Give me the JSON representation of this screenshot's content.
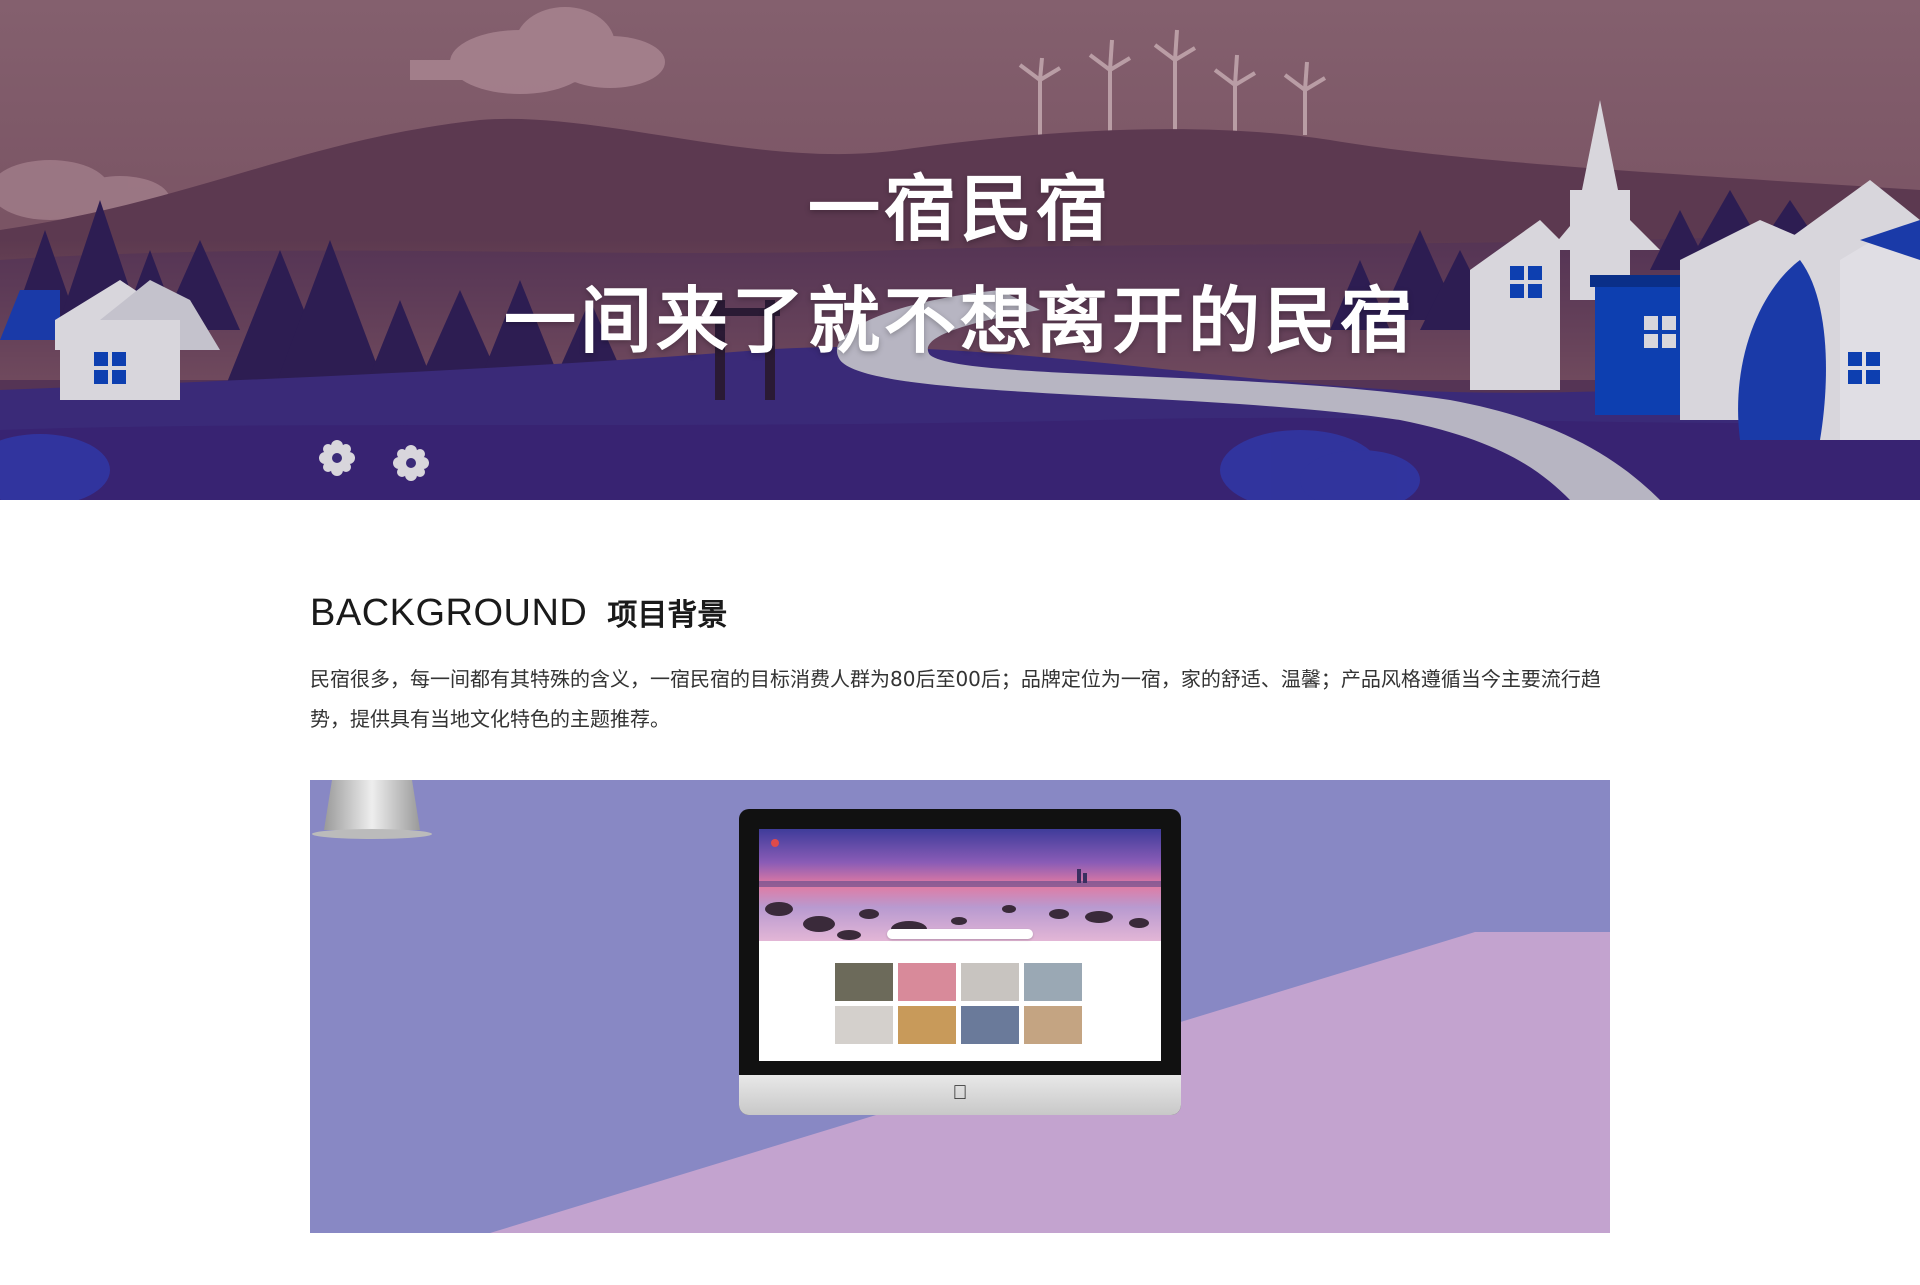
{
  "hero": {
    "title": "一宿民宿",
    "subtitle": "一间来了就不想离开的民宿"
  },
  "background_section": {
    "heading_en": "BACKGROUND",
    "heading_zh": "项目背景",
    "paragraph": "民宿很多，每一间都有其特殊的含义，一宿民宿的目标消费人群为80后至00后；品牌定位为一宿，家的舒适、温馨；产品风格遵循当今主要流行趋势，提供具有当地文化特色的主题推荐。"
  },
  "colors": {
    "showcase_bg": "#8888c4",
    "showcase_band": "#c3a3cf",
    "hero_sky": "#7a5062",
    "hero_ground": "#3a2a78",
    "house_blue": "#0d3fb0"
  },
  "icons": [
    "flower-icon",
    "apple-icon",
    "window-icon"
  ]
}
